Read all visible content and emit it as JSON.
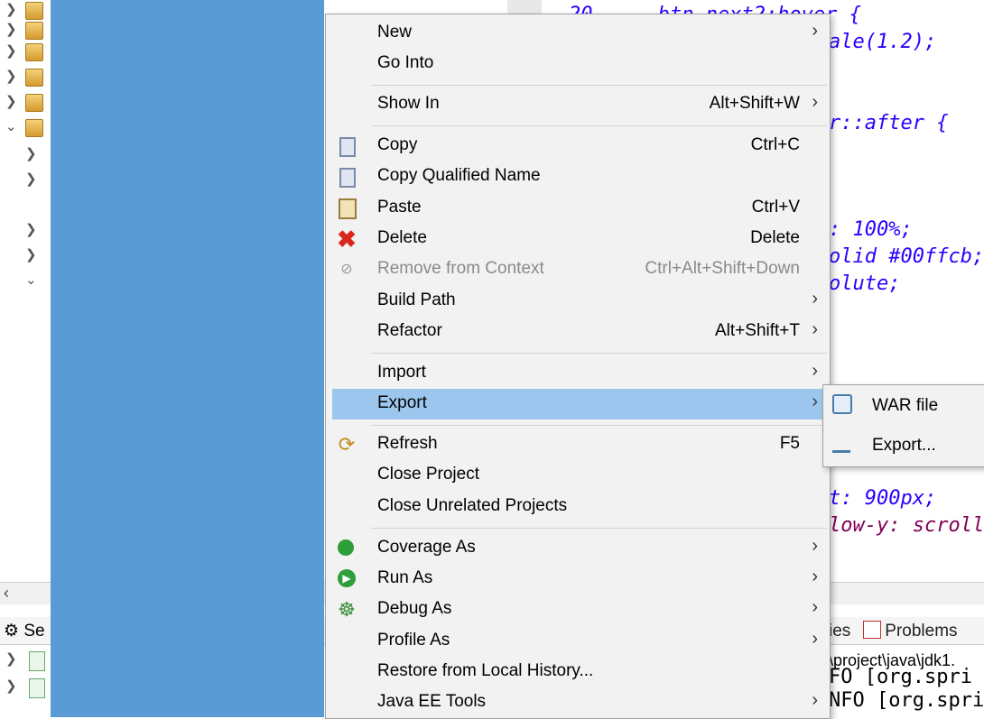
{
  "editor": {
    "line_number": "20",
    "code_lines": [
      {
        "text": "  .btn_next2:hover {"
      },
      {
        "text": "ale(1.2);"
      },
      {
        "text": "r::after {"
      },
      {
        "text": ": 100%;"
      },
      {
        "text": "olid #00ffcb;"
      },
      {
        "text": "olute;"
      },
      {
        "text": "t: 900px;"
      },
      {
        "text": "low-y: scroll"
      }
    ]
  },
  "bottom_panel": {
    "left_tab_label": "Se",
    "right_tabs_label": "ies",
    "problems_label": "Problems",
    "console_path": "\\project\\java\\jdk1.",
    "console_lines": [
      "FO [org.spri",
      "NFO [org.spri"
    ]
  },
  "menu": {
    "new": {
      "label": "New"
    },
    "go_into": {
      "label": "Go Into"
    },
    "show_in": {
      "label": "Show In",
      "shortcut": "Alt+Shift+W"
    },
    "copy": {
      "label": "Copy",
      "shortcut": "Ctrl+C",
      "icon": "copy-icon"
    },
    "copy_qualified_name": {
      "label": "Copy Qualified Name",
      "icon": "copy-qualified-icon"
    },
    "paste": {
      "label": "Paste",
      "shortcut": "Ctrl+V",
      "icon": "paste-icon"
    },
    "delete": {
      "label": "Delete",
      "shortcut": "Delete",
      "icon": "delete-icon"
    },
    "remove_from_context": {
      "label": "Remove from Context",
      "shortcut": "Ctrl+Alt+Shift+Down",
      "icon": "remove-context-icon"
    },
    "build_path": {
      "label": "Build Path"
    },
    "refactor": {
      "label": "Refactor",
      "shortcut": "Alt+Shift+T"
    },
    "import": {
      "label": "Import"
    },
    "export": {
      "label": "Export"
    },
    "refresh": {
      "label": "Refresh",
      "shortcut": "F5",
      "icon": "refresh-icon"
    },
    "close_project": {
      "label": "Close Project"
    },
    "close_unrelated": {
      "label": "Close Unrelated Projects"
    },
    "coverage_as": {
      "label": "Coverage As",
      "icon": "coverage-icon"
    },
    "run_as": {
      "label": "Run As",
      "icon": "run-icon"
    },
    "debug_as": {
      "label": "Debug As",
      "icon": "debug-icon"
    },
    "profile_as": {
      "label": "Profile As"
    },
    "restore_history": {
      "label": "Restore from Local History..."
    },
    "java_ee_tools": {
      "label": "Java EE Tools"
    }
  },
  "submenu": {
    "war_file": {
      "label": "WAR file",
      "icon": "war-file-icon"
    },
    "export_more": {
      "label": "Export...",
      "icon": "export-icon"
    }
  },
  "colors": {
    "selected_panel": "#5b9bd5",
    "menu_highlight": "#9dc6ef",
    "menu_bg": "#f2f2f2"
  }
}
